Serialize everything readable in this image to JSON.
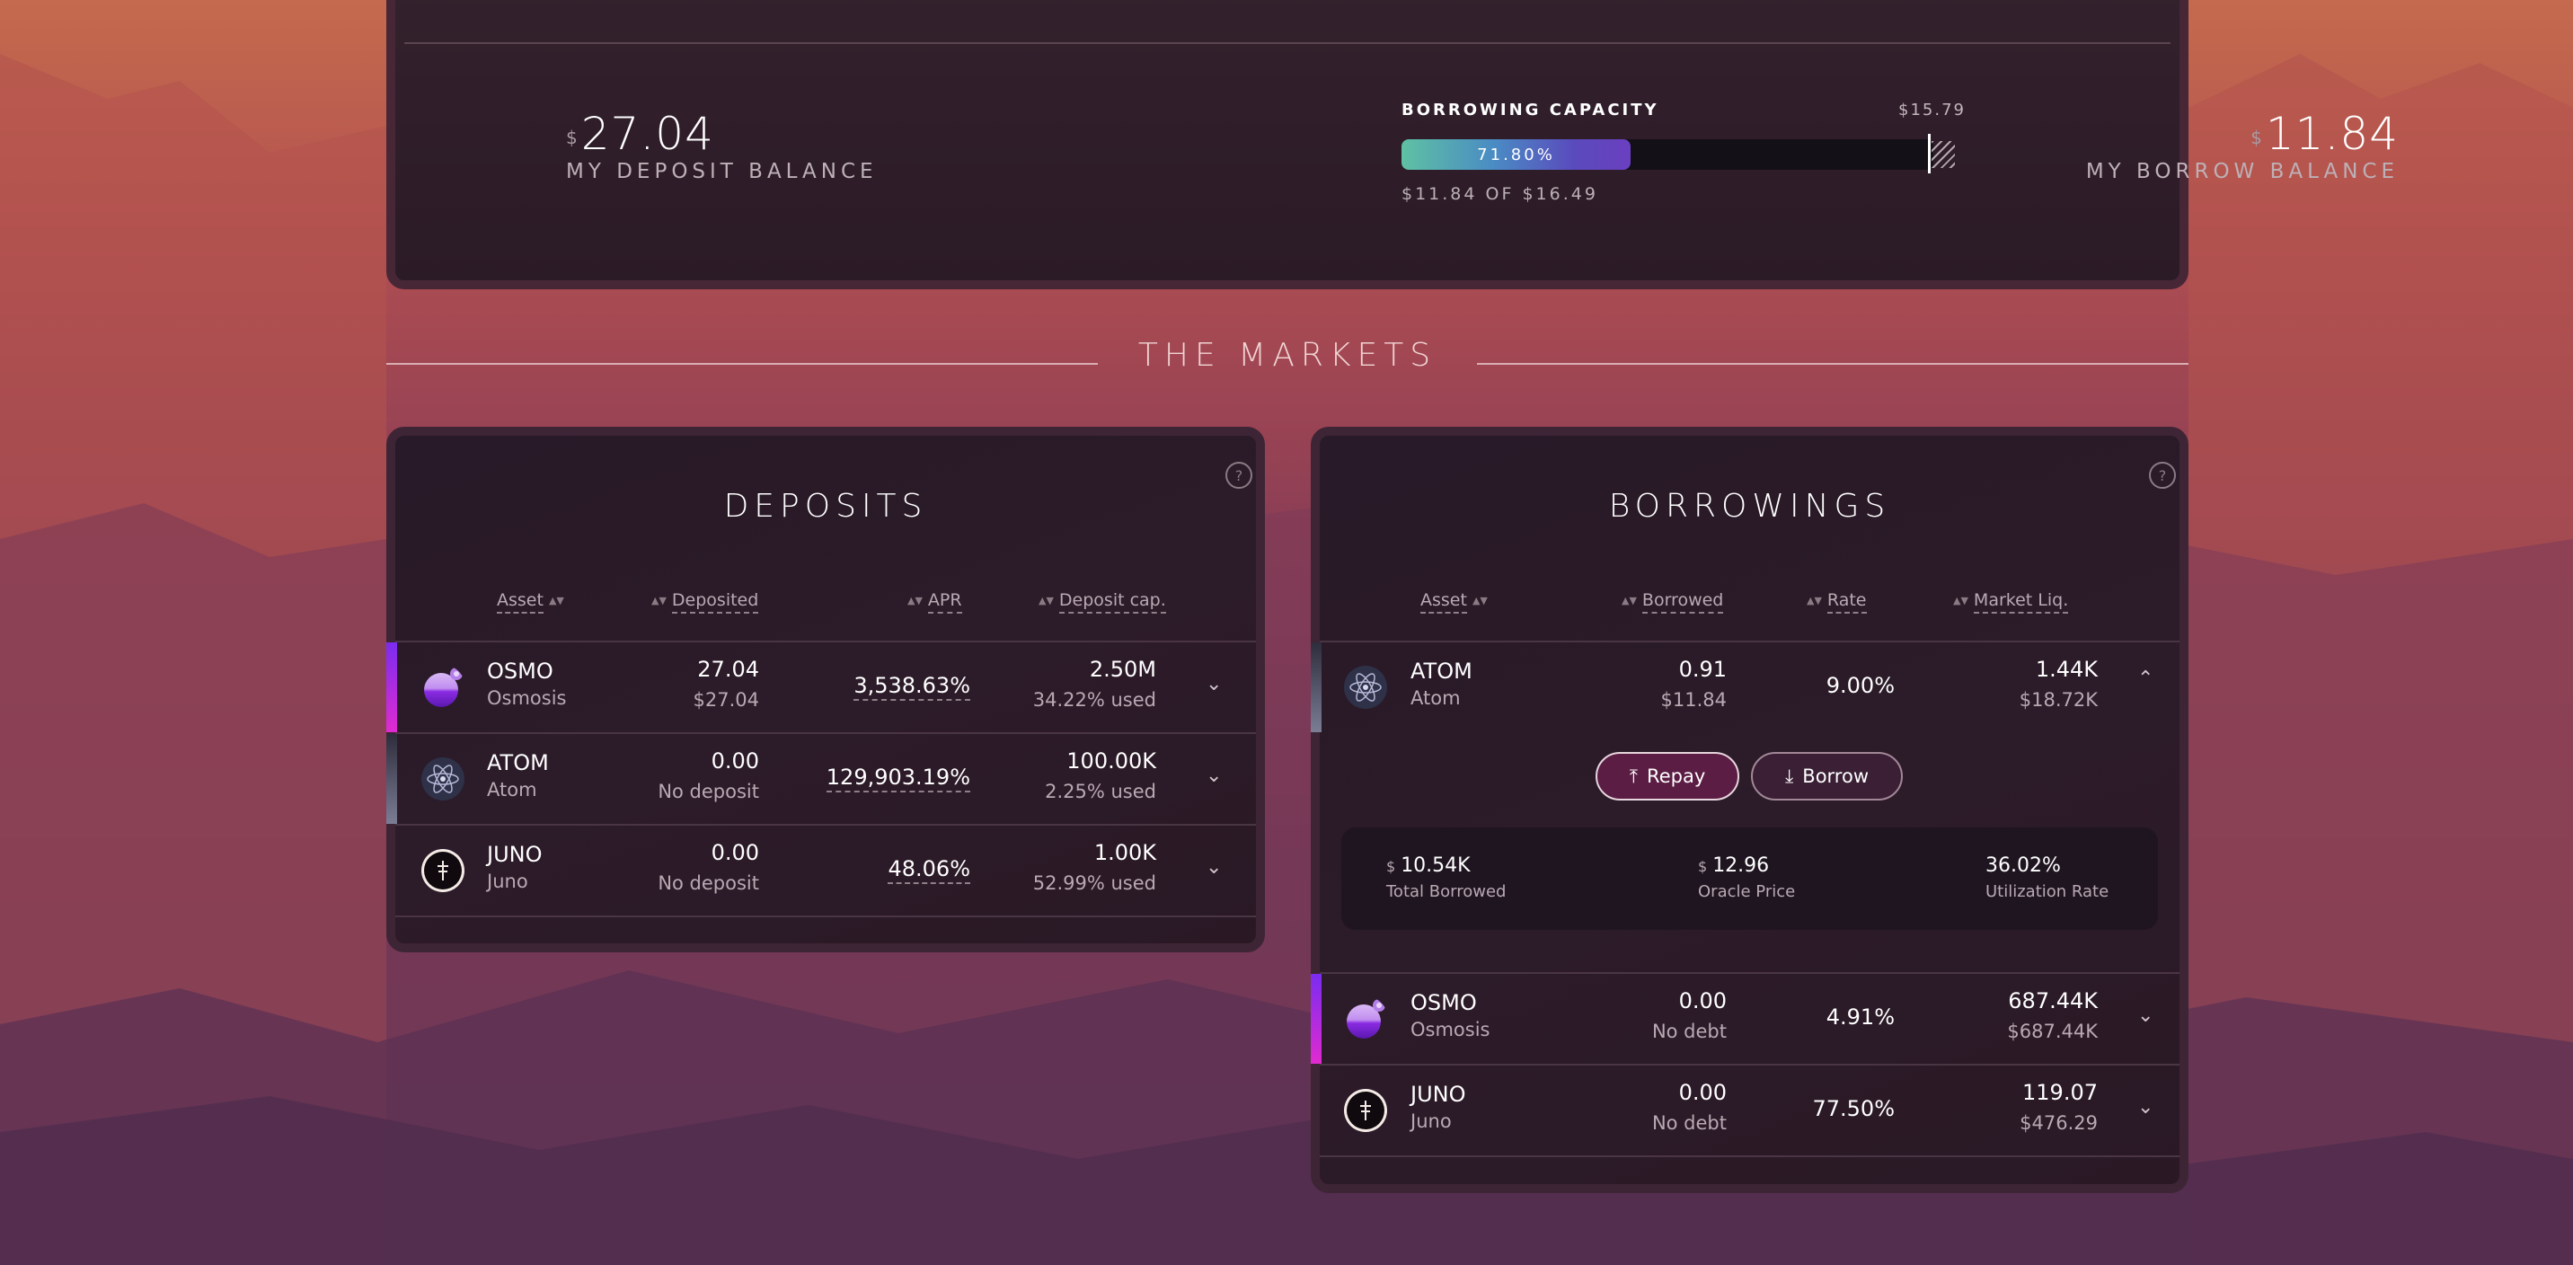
{
  "summary": {
    "deposit": {
      "currency": "$",
      "value": "27.04",
      "label": "MY DEPOSIT BALANCE"
    },
    "borrow": {
      "currency": "$",
      "value": "11.84",
      "label": "MY BORROW BALANCE"
    },
    "capacity": {
      "title": "BORROWING CAPACITY",
      "max": "$15.79",
      "percent_label": "71.80%",
      "percent": 71.8,
      "footer": "$11.84 OF $16.49"
    }
  },
  "markets_title": "THE MARKETS",
  "deposits": {
    "title": "DEPOSITS",
    "help": "?",
    "columns": [
      "Asset",
      "Deposited",
      "APR",
      "Deposit cap."
    ],
    "rows": [
      {
        "symbol": "OSMO",
        "name": "Osmosis",
        "amount": "27.04",
        "amount_sub": "$27.04",
        "apr": "3,538.63%",
        "cap": "2.50M",
        "cap_sub": "34.22% used",
        "icon": "osmo-icon"
      },
      {
        "symbol": "ATOM",
        "name": "Atom",
        "amount": "0.00",
        "amount_sub": "No deposit",
        "apr": "129,903.19%",
        "cap": "100.00K",
        "cap_sub": "2.25% used",
        "icon": "atom-icon"
      },
      {
        "symbol": "JUNO",
        "name": "Juno",
        "amount": "0.00",
        "amount_sub": "No deposit",
        "apr": "48.06%",
        "cap": "1.00K",
        "cap_sub": "52.99% used",
        "icon": "juno-icon"
      }
    ]
  },
  "borrowings": {
    "title": "BORROWINGS",
    "help": "?",
    "columns": [
      "Asset",
      "Borrowed",
      "Rate",
      "Market Liq."
    ],
    "rows": [
      {
        "symbol": "ATOM",
        "name": "Atom",
        "amount": "0.91",
        "amount_sub": "$11.84",
        "rate": "9.00%",
        "liq": "1.44K",
        "liq_sub": "$18.72K",
        "icon": "atom-icon"
      },
      {
        "symbol": "OSMO",
        "name": "Osmosis",
        "amount": "0.00",
        "amount_sub": "No debt",
        "rate": "4.91%",
        "liq": "687.44K",
        "liq_sub": "$687.44K",
        "icon": "osmo-icon"
      },
      {
        "symbol": "JUNO",
        "name": "Juno",
        "amount": "0.00",
        "amount_sub": "No debt",
        "rate": "77.50%",
        "liq": "119.07",
        "liq_sub": "$476.29",
        "icon": "juno-icon"
      }
    ],
    "expanded": {
      "repay_label": "Repay",
      "borrow_label": "Borrow",
      "stats": [
        {
          "currency": "$",
          "value": "10.54K",
          "label": "Total Borrowed"
        },
        {
          "currency": "$",
          "value": "12.96",
          "label": "Oracle Price"
        },
        {
          "currency": "",
          "value": "36.02%",
          "label": "Utilization Rate"
        }
      ]
    }
  }
}
